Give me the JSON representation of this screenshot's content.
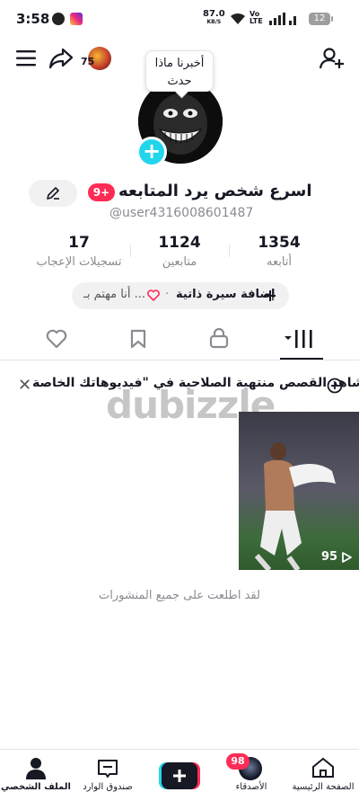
{
  "status_bar": {
    "time": "3:58",
    "net_speed": "87.0",
    "net_unit": "KB/S",
    "network": "Vo LTE",
    "battery": "12"
  },
  "top_nav": {
    "coins": "75",
    "icons": [
      "menu-icon",
      "share-icon",
      "add-friend-icon"
    ]
  },
  "profile": {
    "bubble_text": "أخبرنا ماذا حدث",
    "name": "اسرع شخص يرد المتابعه",
    "badge": "9+",
    "username": "@user4316008601487",
    "stats": [
      {
        "value": "1354",
        "label": "أتابعه"
      },
      {
        "value": "1124",
        "label": "متابعين"
      },
      {
        "value": "17",
        "label": "تسجيلات الإعجاب"
      }
    ],
    "bio_add": "إضافة سيرة ذاتية",
    "bio_interest": "أنا مهتم بـ ...",
    "bio_dot": "·"
  },
  "promo": {
    "text": "شاهد القصص منتهية الصلاحية في \"فيديوهاتك الخاصة\"",
    "watermark": "dubizzle"
  },
  "video": {
    "views": "95"
  },
  "seen_all": "لقد اطلعت على جميع المنشورات",
  "bottom_nav": {
    "home": "الصفحة الرئيسية",
    "friends": "الأصدقاء",
    "friends_badge": "98",
    "inbox": "صندوق الوارد",
    "profile": "الملف الشخصي"
  },
  "colors": {
    "accent_red": "#fe2c55",
    "accent_cyan": "#20d5ec",
    "text": "#161823",
    "muted": "#8a8b91"
  }
}
